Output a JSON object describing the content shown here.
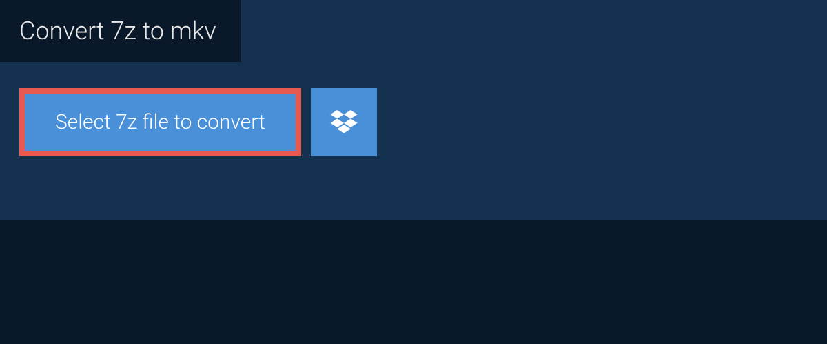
{
  "header": {
    "title": "Convert 7z to mkv"
  },
  "actions": {
    "select_label": "Select 7z file to convert",
    "dropbox_icon": "dropbox"
  },
  "colors": {
    "page_bg": "#0a1929",
    "panel_bg": "#14324f",
    "button_bg": "#4a90d9",
    "highlight_border": "#e85a4f",
    "text_light": "#e8e8e8"
  }
}
